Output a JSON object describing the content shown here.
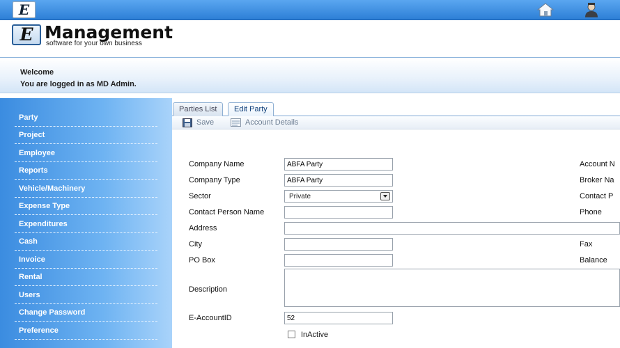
{
  "topbar": {
    "logo_letter": "E",
    "home_icon": "home-icon",
    "user_icon": "user-icon"
  },
  "header": {
    "logo_letter": "E",
    "brand_name": "Management",
    "tagline": "software for your own business"
  },
  "welcome": {
    "line1": "Welcome",
    "line2": "You are logged in as MD Admin."
  },
  "sidebar": {
    "items": [
      {
        "label": "Party"
      },
      {
        "label": "Project"
      },
      {
        "label": "Employee"
      },
      {
        "label": "Reports"
      },
      {
        "label": "Vehicle/Machinery"
      },
      {
        "label": "Expense Type"
      },
      {
        "label": "Expenditures"
      },
      {
        "label": "Cash"
      },
      {
        "label": "Invoice"
      },
      {
        "label": "Rental"
      },
      {
        "label": "Users"
      },
      {
        "label": "Change Password"
      },
      {
        "label": "Preference"
      }
    ]
  },
  "tabs": [
    {
      "label": "Parties List",
      "active": false
    },
    {
      "label": "Edit Party",
      "active": true
    }
  ],
  "toolbar": {
    "save_label": "Save",
    "account_details_label": "Account Details"
  },
  "form": {
    "company_name": {
      "label": "Company Name",
      "value": "ABFA Party"
    },
    "company_type": {
      "label": "Company Type",
      "value": "ABFA Party"
    },
    "sector": {
      "label": "Sector",
      "value": "Private"
    },
    "contact_person_name": {
      "label": "Contact Person Name",
      "value": ""
    },
    "address": {
      "label": "Address",
      "value": ""
    },
    "city": {
      "label": "City",
      "value": ""
    },
    "po_box": {
      "label": "PO Box",
      "value": ""
    },
    "description": {
      "label": "Description",
      "value": ""
    },
    "e_account_id": {
      "label": "E-AccountID",
      "value": "52"
    },
    "inactive": {
      "label": "InActive",
      "checked": false
    },
    "right_labels": {
      "account_no": "Account N",
      "broker_name": "Broker Na",
      "contact_p": "Contact P",
      "phone": "Phone",
      "fax": "Fax",
      "balance": "Balance"
    }
  }
}
